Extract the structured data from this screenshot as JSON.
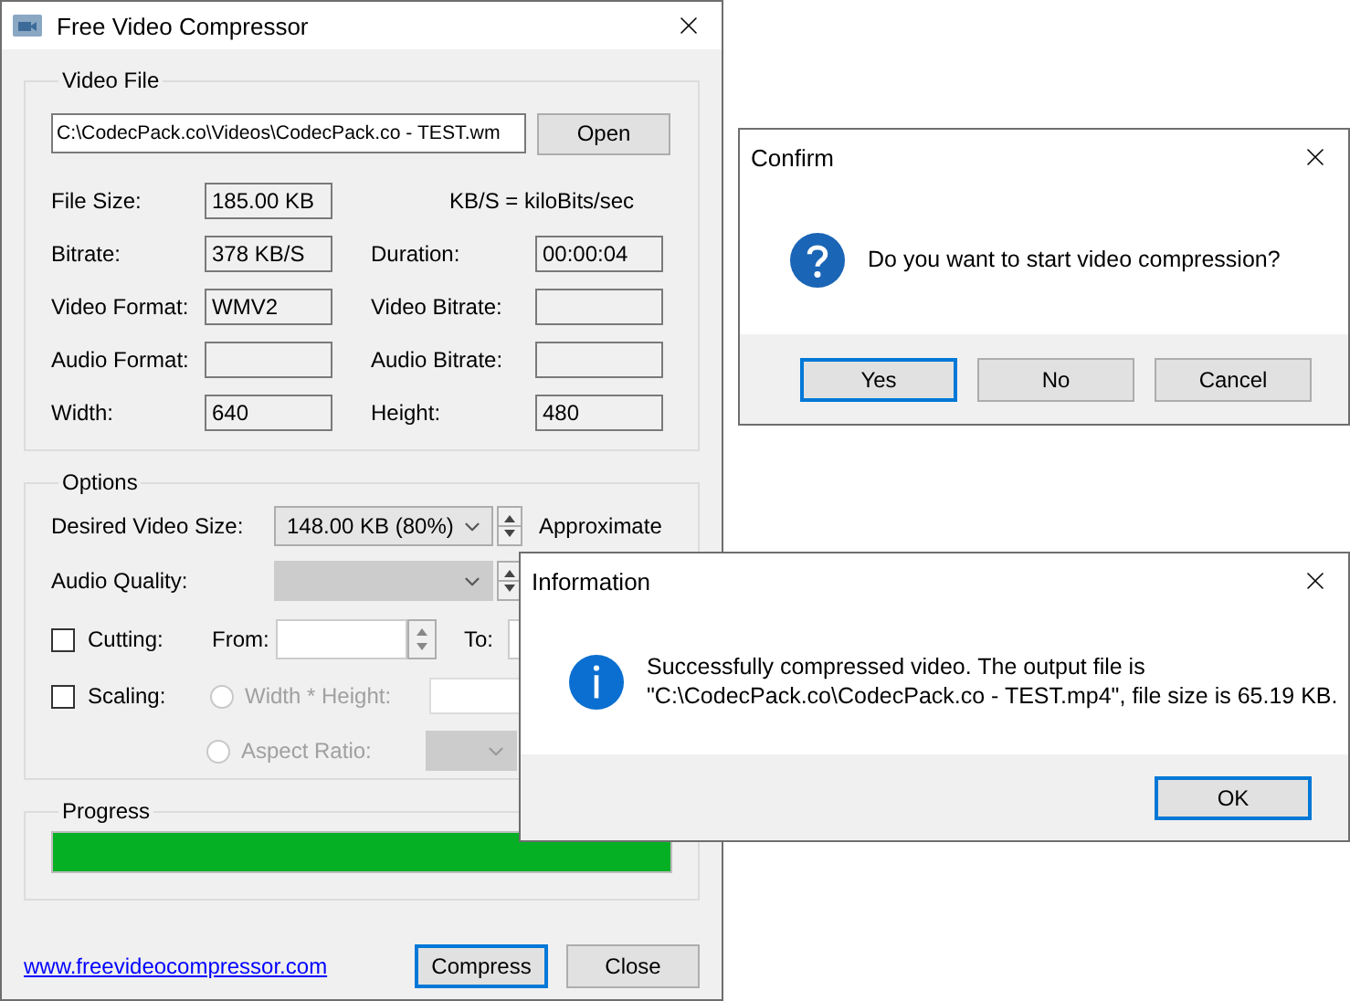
{
  "main_window": {
    "title": "Free Video Compressor",
    "video_file": {
      "heading": "Video File",
      "path": "C:\\CodecPack.co\\Videos\\CodecPack.co - TEST.wm",
      "open_button": "Open",
      "note": "KB/S = kiloBits/sec",
      "left_fields": [
        {
          "label": "File Size:",
          "value": "185.00 KB"
        },
        {
          "label": "Bitrate:",
          "value": "378 KB/S"
        },
        {
          "label": "Video Format:",
          "value": "WMV2"
        },
        {
          "label": "Audio Format:"
        },
        {
          "label": "Width:",
          "value": "640"
        }
      ],
      "right_fields": [
        {
          "label": "Duration:",
          "value": "00:00:04"
        },
        {
          "label": "Video Bitrate:"
        },
        {
          "label": "Audio Bitrate:"
        },
        {
          "label": "Height:",
          "value": "480"
        }
      ]
    },
    "options": {
      "heading": "Options",
      "desired_size": {
        "label": "Desired Video Size:",
        "value": "148.00 KB (80%)",
        "suffix": "Approximate"
      },
      "audio_quality": {
        "label": "Audio Quality:",
        "disabled": true
      },
      "cutting": {
        "label": "Cutting:",
        "checked": false,
        "from_label": "From:",
        "to_label": "To:"
      },
      "scaling": {
        "label": "Scaling:",
        "checked": false,
        "modes": [
          {
            "label": "Width * Height:",
            "selected": false,
            "disabled": true,
            "kind": "field"
          },
          {
            "label": "Aspect Ratio:",
            "selected": false,
            "disabled": true,
            "kind": "combo"
          }
        ]
      }
    },
    "progress": {
      "heading": "Progress",
      "level": 1
    },
    "link": "www.freevideocompressor.com",
    "buttons": [
      {
        "label": "Compress",
        "default": true
      },
      {
        "label": "Close",
        "default": false
      }
    ]
  },
  "confirm_dialog": {
    "title": "Confirm",
    "message": "Do you want to start video compression?",
    "buttons": [
      {
        "label": "Yes",
        "default": true
      },
      {
        "label": "No",
        "default": false
      },
      {
        "label": "Cancel",
        "default": false
      }
    ]
  },
  "info_dialog": {
    "title": "Information",
    "message": "Successfully compressed video. The output file is \"C:\\CodecPack.co\\CodecPack.co - TEST.mp4\", file size is 65.19 KB.",
    "buttons": [
      {
        "label": "OK",
        "default": true
      }
    ]
  }
}
